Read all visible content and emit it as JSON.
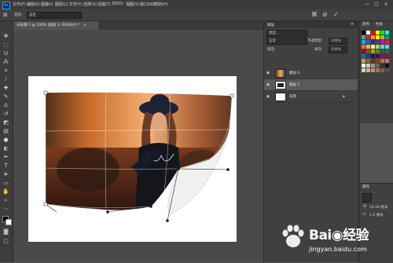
{
  "app": {
    "logo": "Ps"
  },
  "menu": [
    "文件(F)",
    "编辑(E)",
    "图像(I)",
    "图层(L)",
    "文字(Y)",
    "选择(S)",
    "滤镜(T)",
    "3D(D)",
    "视图(V)",
    "窗口(W)",
    "帮助(H)"
  ],
  "window_controls": {
    "minimize": "—",
    "restore": "□",
    "close": "✕"
  },
  "options_bar": {
    "mode_label": "变形:",
    "mode_value": "自定",
    "confirm": "✓",
    "cancel": "⊘"
  },
  "document": {
    "tab_title": "未标题-1 @ 100% (图层 1, RGB/8#) *",
    "tab_close": "×"
  },
  "tools": [
    "move-icon",
    "marquee-icon",
    "lasso-icon",
    "wand-icon",
    "crop-icon",
    "eyedropper-icon",
    "heal-icon",
    "brush-icon",
    "stamp-icon",
    "history-brush-icon",
    "eraser-icon",
    "gradient-icon",
    "blur-icon",
    "dodge-icon",
    "pen-icon",
    "type-icon",
    "path-select-icon",
    "shape-icon",
    "hand-icon",
    "zoom-icon"
  ],
  "layers_panel": {
    "tab_label": "图层",
    "kind_label": "类型",
    "blend_mode": "正常",
    "opacity_label": "不透明度:",
    "opacity_value": "100%",
    "lock_label": "锁定:",
    "fill_label": "填充:",
    "fill_value": "100%",
    "layers": [
      {
        "name": "图层 0",
        "selected": false
      },
      {
        "name": "图层 1",
        "selected": true
      },
      {
        "name": "背景",
        "selected": false
      }
    ]
  },
  "swatches_panel": {
    "tab1": "颜色",
    "tab2": "色板"
  },
  "properties_panel": {
    "tab": "属性",
    "w_value": "14.28 厘米",
    "h_value": "1.4 厘米"
  },
  "colors": {
    "accent": "#31a8ff",
    "panel": "#404040",
    "canvas": "#4a4a4a"
  },
  "watermark": {
    "brand": "Bai◉经验",
    "url": "jingyan.baidu.com"
  }
}
